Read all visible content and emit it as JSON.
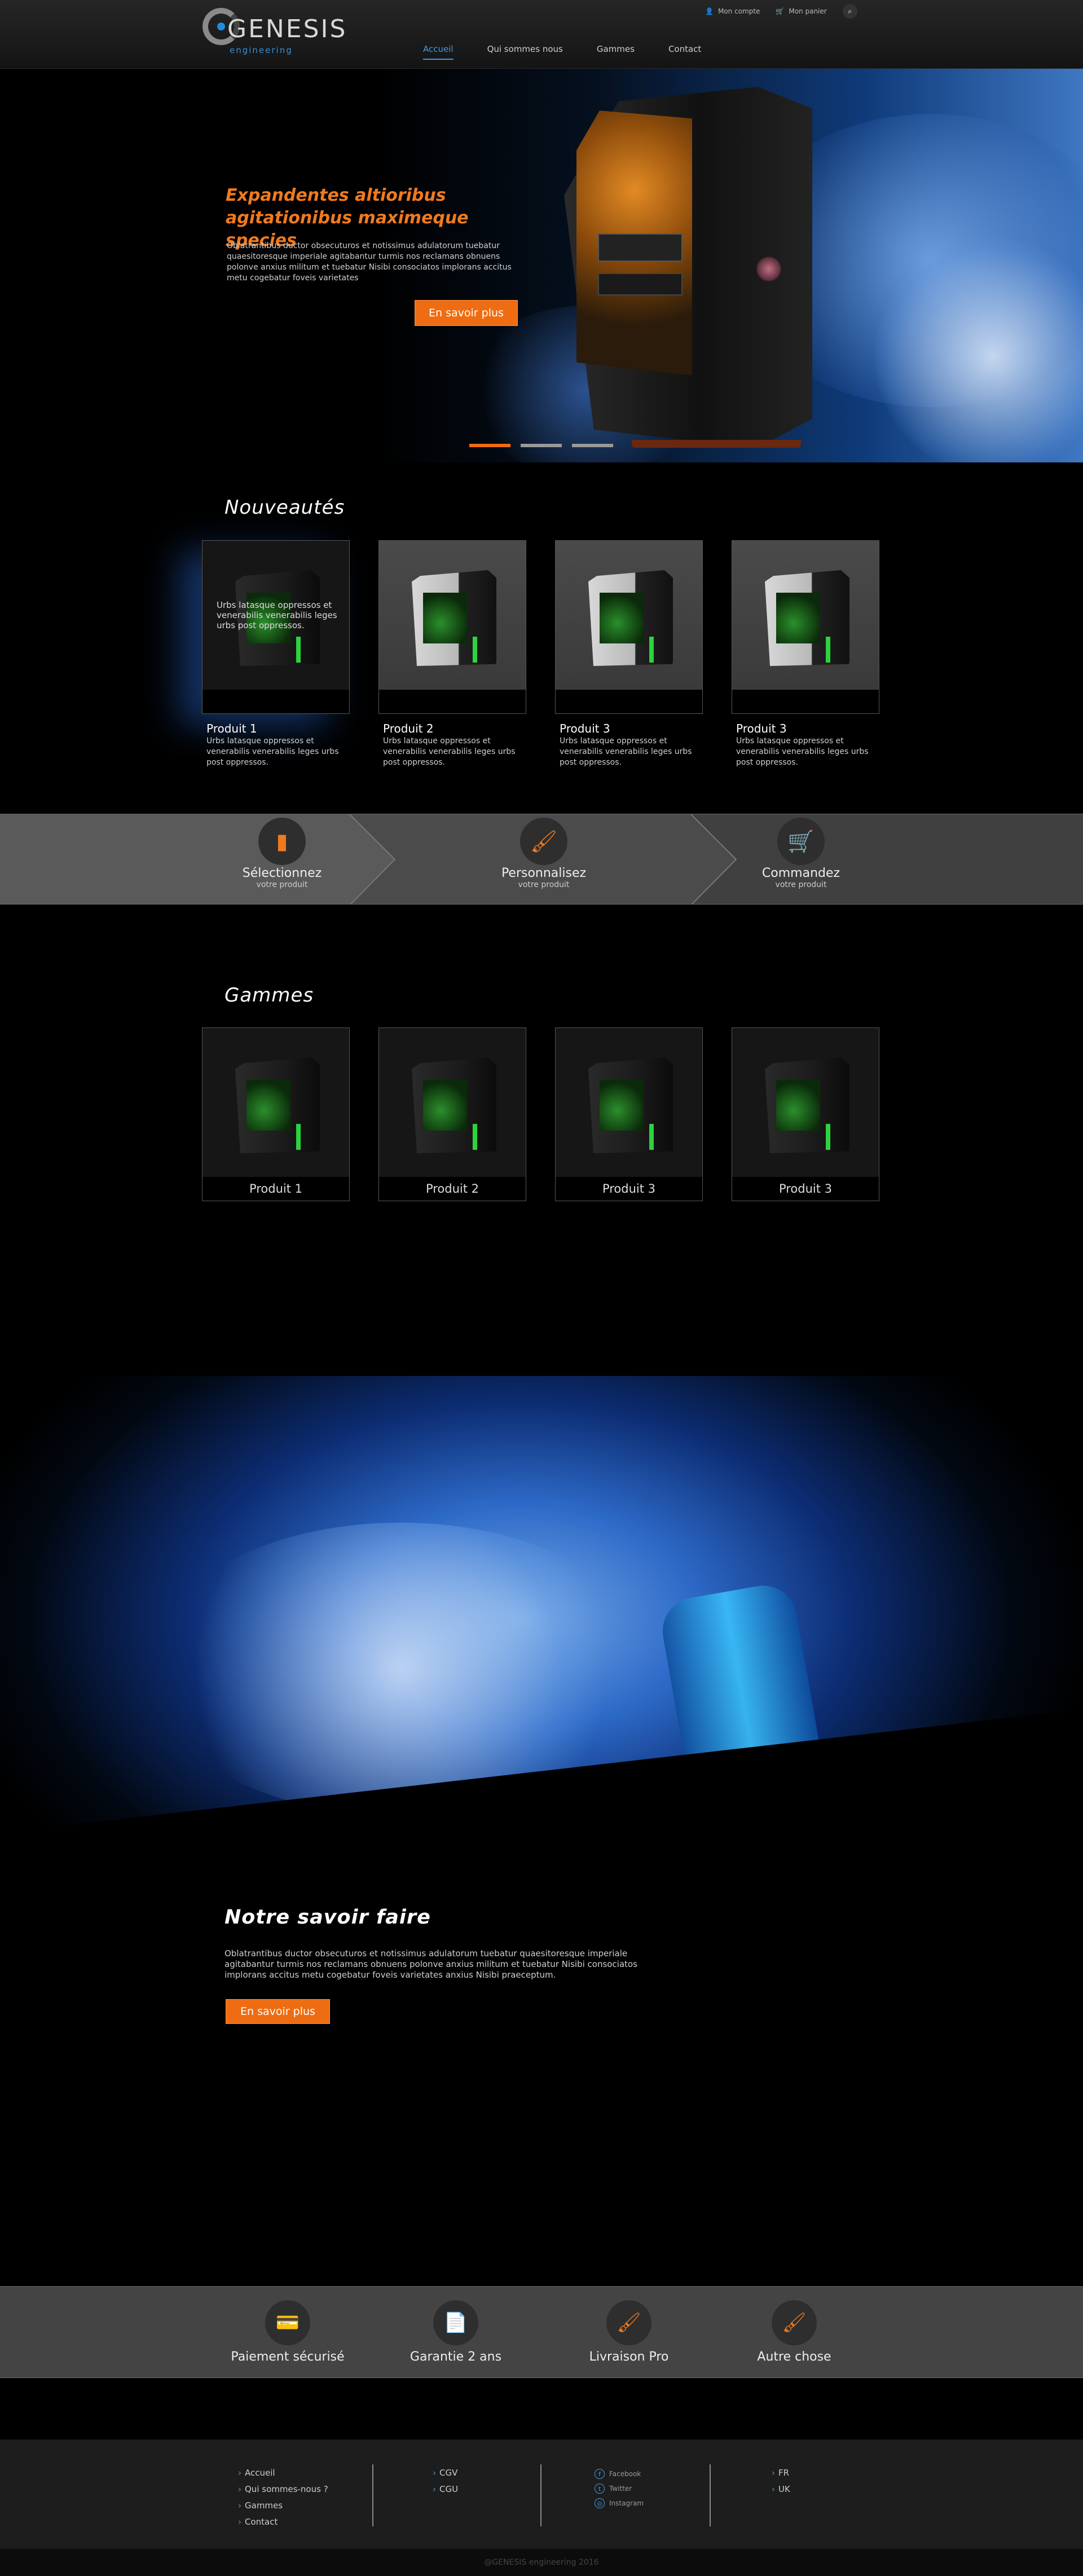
{
  "header": {
    "logo_text": "GENESIS",
    "logo_sub": "engineering",
    "account_label": "Mon compte",
    "cart_label": "Mon panier",
    "nav": [
      {
        "label": "Accueil",
        "active": true
      },
      {
        "label": "Qui sommes nous",
        "active": false
      },
      {
        "label": "Gammes",
        "active": false
      },
      {
        "label": "Contact",
        "active": false
      }
    ]
  },
  "hero": {
    "title": "Expandentes altioribus agitationibus maximeque species",
    "text": "Oblatrantibus ductor obsecuturos et notissimus adulatorum tuebatur quaesitoresque imperiale agitabantur turmis nos reclamans obnuens polonve anxius militum et tuebatur Nisibi consociatos implorans accitus metu cogebatur foveis varietates",
    "button": "En savoir plus",
    "slides": 3,
    "active_slide": 1
  },
  "news": {
    "title": "Nouveautés",
    "overlay_text": "Urbs latasque oppressos et venerabilis venerabilis leges urbs post oppressos.",
    "items": [
      {
        "name": "Produit 1",
        "desc": "Urbs latasque oppressos et venerabilis venerabilis leges urbs post oppressos."
      },
      {
        "name": "Produit 2",
        "desc": "Urbs latasque oppressos et venerabilis venerabilis leges urbs post oppressos."
      },
      {
        "name": "Produit 3",
        "desc": "Urbs latasque oppressos et venerabilis venerabilis leges urbs post oppressos."
      },
      {
        "name": "Produit 3",
        "desc": "Urbs latasque oppressos et venerabilis venerabilis leges urbs post oppressos."
      }
    ]
  },
  "steps": [
    {
      "title": "Sélectionnez",
      "sub": "votre produit",
      "icon": "pc-case-icon"
    },
    {
      "title": "Personnalisez",
      "sub": "votre produit",
      "icon": "paintbrush-icon"
    },
    {
      "title": "Commandez",
      "sub": "votre produit",
      "icon": "cart-icon"
    }
  ],
  "ranges": {
    "title": "Gammes",
    "items": [
      "Produit 1",
      "Produit 2",
      "Produit 3",
      "Produit 3"
    ]
  },
  "savoir_faire": {
    "title": "Notre savoir faire",
    "text": "Oblatrantibus ductor obsecuturos et notissimus adulatorum tuebatur quaesitoresque imperiale agitabantur turmis nos reclamans obnuens polonve anxius militum et tuebatur Nisibi consociatos implorans accitus metu cogebatur foveis varietates anxius Nisibi praeceptum.",
    "button": "En savoir plus"
  },
  "features": [
    {
      "label": "Paiement sécurisé",
      "icon": "secure-payment-icon"
    },
    {
      "label": "Garantie 2 ans",
      "icon": "warranty-document-icon"
    },
    {
      "label": "Livraison Pro",
      "icon": "paintbrush-icon"
    },
    {
      "label": "Autre chose",
      "icon": "paintbrush-icon"
    }
  ],
  "footer": {
    "nav": [
      "Accueil",
      "Qui sommes-nous ?",
      "Gammes",
      "Contact"
    ],
    "legal": [
      "CGV",
      "CGU"
    ],
    "social": [
      {
        "label": "Facebook",
        "icon": "facebook-icon"
      },
      {
        "label": "Twitter",
        "icon": "twitter-icon"
      },
      {
        "label": "Instagram",
        "icon": "instagram-icon"
      }
    ],
    "languages": [
      "FR",
      "UK"
    ],
    "copyright": "@GENESIS engineering 2016"
  },
  "colors": {
    "accent_orange": "#ef6d12",
    "accent_blue": "#3d9be9",
    "band_gray": "#444444"
  }
}
